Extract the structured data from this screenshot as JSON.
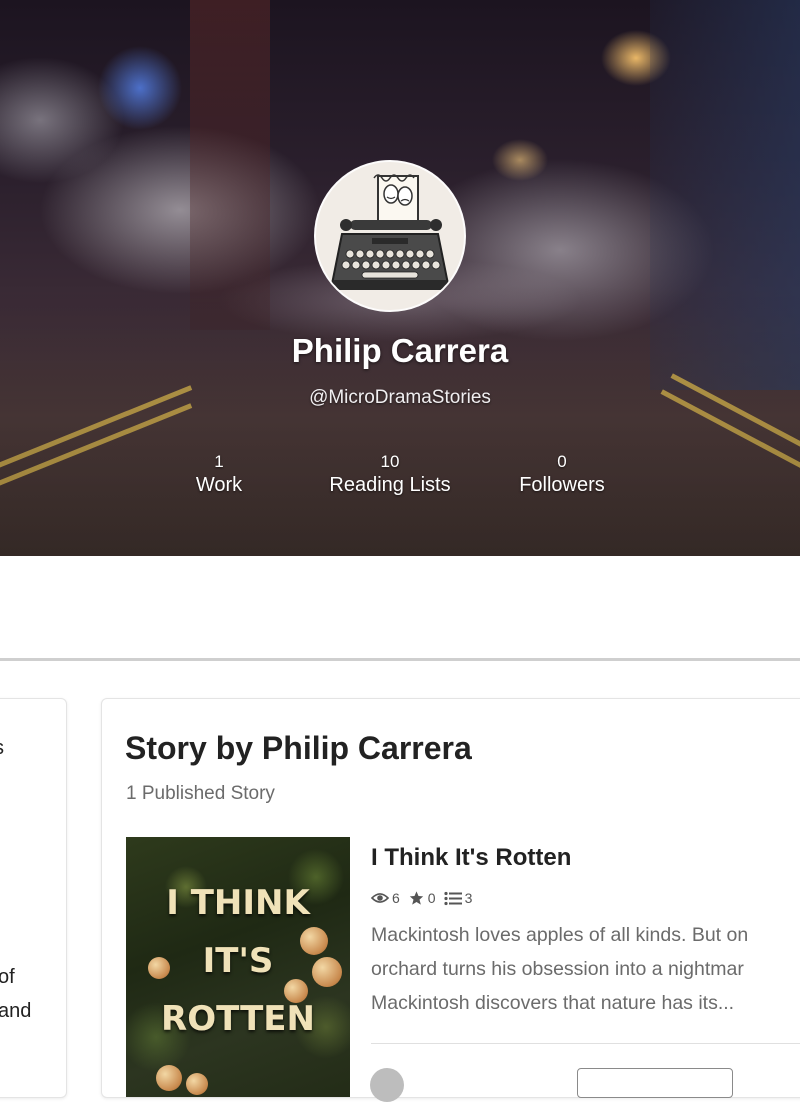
{
  "profile": {
    "name": "Philip Carrera",
    "handle": "@MicroDramaStories",
    "stats": [
      {
        "value": "1",
        "label": "Work"
      },
      {
        "value": "10",
        "label": "Reading Lists"
      },
      {
        "value": "0",
        "label": "Followers"
      }
    ]
  },
  "left_card": {
    "fragments": [
      "s",
      "of",
      "and"
    ]
  },
  "stories": {
    "heading": "Story by Philip Carrera",
    "count_text": "1 Published Story",
    "items": [
      {
        "title": "I Think It's Rotten",
        "cover_lines": [
          "I THINK",
          "IT'S",
          "ROTTEN"
        ],
        "reads": "6",
        "votes": "0",
        "parts": "3",
        "description_lines": [
          "Mackintosh loves apples of all kinds. But on",
          "orchard turns his obsession into a nightmar",
          "Mackintosh discovers that nature has its..."
        ]
      }
    ]
  },
  "icons": {
    "reads": "eye-icon",
    "votes": "star-icon",
    "parts": "list-icon"
  }
}
